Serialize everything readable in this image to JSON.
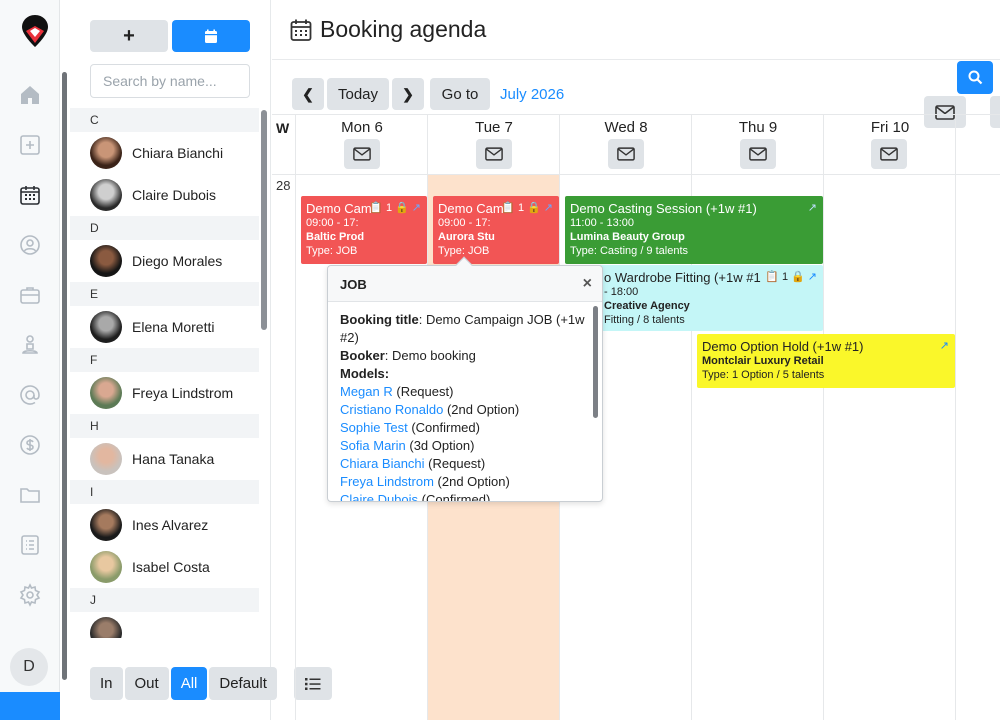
{
  "rail": {
    "items": [
      "home-icon",
      "plus-square-icon",
      "calendar-icon",
      "user-circle-icon",
      "briefcase-icon",
      "person-pedestal-icon",
      "at-icon",
      "dollar-icon",
      "folder-icon",
      "checklist-icon",
      "gear-icon"
    ],
    "avatar_initial": "D"
  },
  "sidebar": {
    "search_placeholder": "Search by name...",
    "groups": [
      {
        "letter": "C",
        "people": [
          "Chiara Bianchi",
          "Claire Dubois"
        ]
      },
      {
        "letter": "D",
        "people": [
          "Diego Morales"
        ]
      },
      {
        "letter": "E",
        "people": [
          "Elena Moretti"
        ]
      },
      {
        "letter": "F",
        "people": [
          "Freya Lindstrom"
        ]
      },
      {
        "letter": "H",
        "people": [
          "Hana Tanaka"
        ]
      },
      {
        "letter": "I",
        "people": [
          "Ines Alvarez",
          "Isabel Costa"
        ]
      },
      {
        "letter": "J",
        "people": []
      }
    ],
    "filters": [
      "In",
      "Out",
      "All",
      "Default"
    ],
    "active_filter": "All"
  },
  "header": {
    "title": "Booking agenda",
    "today": "Today",
    "goto": "Go to",
    "month": "July 2026"
  },
  "calendar": {
    "week_header": "W",
    "week_number": "28",
    "days": [
      "Mon 6",
      "Tue 7",
      "Wed 8",
      "Thu 9",
      "Fri 10"
    ]
  },
  "events": {
    "mon": {
      "title": "Demo Cam",
      "time": "09:00 - 17:",
      "client": "Baltic Prod",
      "type": "Type: JOB",
      "count": "1"
    },
    "tue": {
      "title": "Demo Cam",
      "time": "09:00 - 17:",
      "client": "Aurora Stu",
      "type": "Type: JOB",
      "count": "1"
    },
    "casting": {
      "title": "Demo Casting Session (+1w #1)",
      "time": "11:00 - 13:00",
      "client": "Lumina Beauty Group",
      "type": "Type: Casting / 9 talents"
    },
    "fitting": {
      "title": "o Wardrobe Fitting (+1w #1",
      "time": "- 18:00",
      "client": "Creative Agency",
      "type": "Fitting / 8 talents",
      "count": "1"
    },
    "option": {
      "title": "Demo Option Hold (+1w #1)",
      "client": "Montclair Luxury Retail",
      "type": "Type: 1 Option / 5 talents"
    }
  },
  "popover": {
    "header": "JOB",
    "close": "×",
    "booking_title_label": "Booking title",
    "booking_title_value": ": Demo Campaign JOB (+1w #2)",
    "booker_label": "Booker",
    "booker_value": ": Demo booking",
    "models_label": "Models:",
    "models": [
      {
        "name": "Megan  R",
        "status": " (Request)"
      },
      {
        "name": "Cristiano Ronaldo",
        "status": " (2nd Option)"
      },
      {
        "name": "Sophie Test",
        "status": " (Confirmed)"
      },
      {
        "name": "Sofia Marin",
        "status": " (3d Option)"
      },
      {
        "name": "Chiara Bianchi",
        "status": " (Request)"
      },
      {
        "name": "Freya Lindstrom",
        "status": " (2nd Option)"
      },
      {
        "name": "Claire Dubois",
        "status": " (Confirmed)"
      }
    ]
  },
  "colors": {
    "accent": "#1a8cff",
    "job": "#f25555",
    "casting": "#3a9c35",
    "fitting": "#c4f6f7",
    "option": "#faf72a",
    "today_bg": "#fde2cc"
  }
}
